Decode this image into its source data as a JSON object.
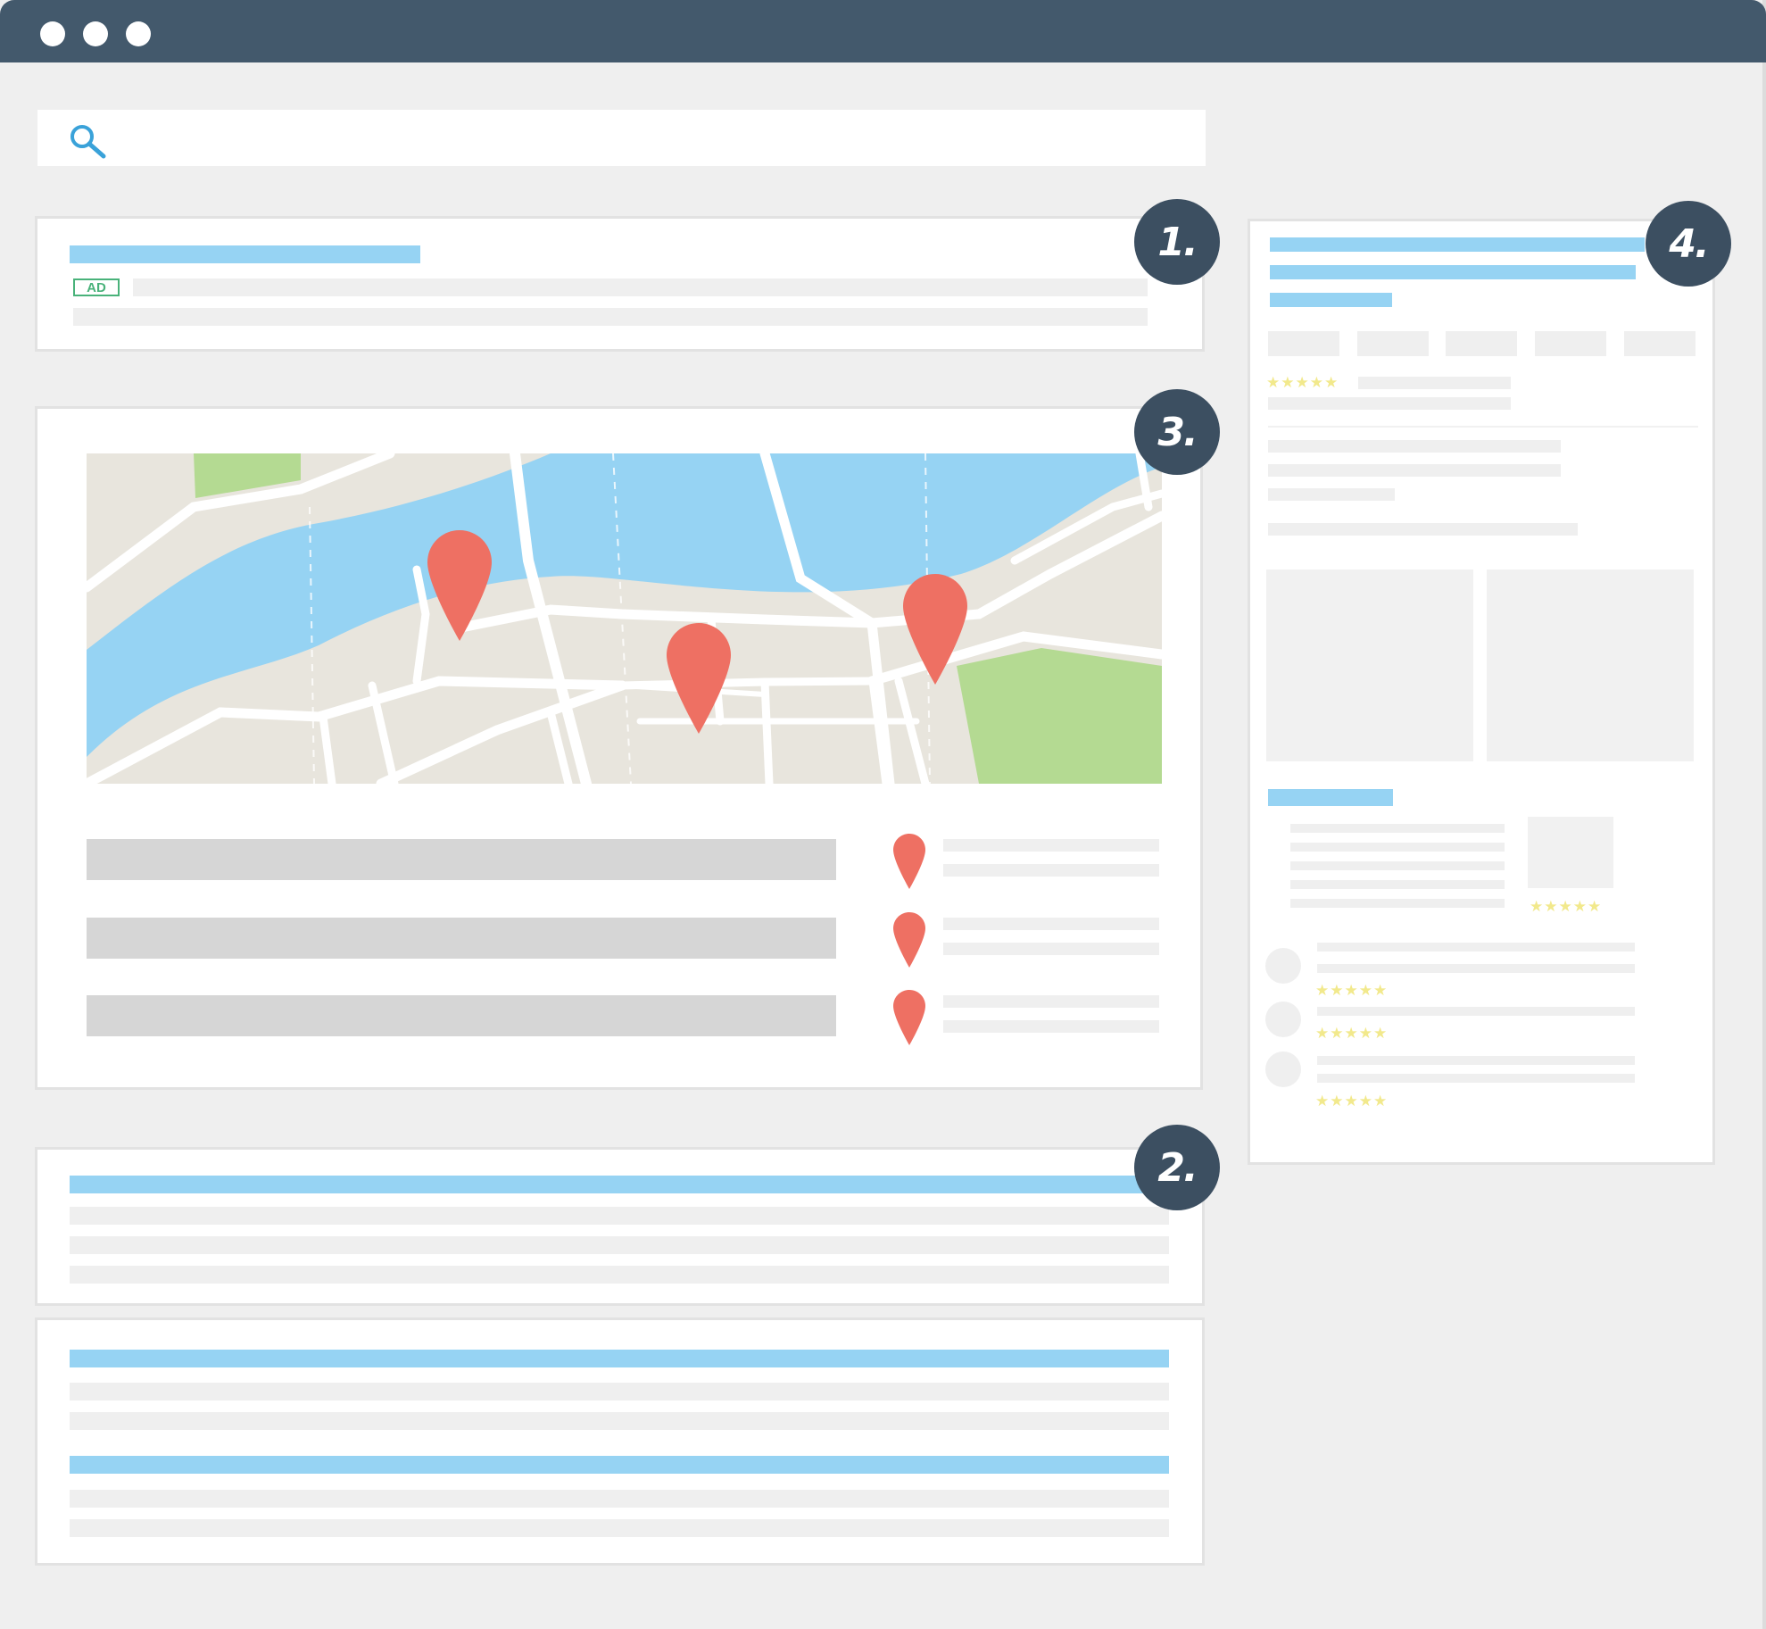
{
  "browser": {
    "window_controls": [
      "dot",
      "dot",
      "dot"
    ],
    "title_bar_color": "#43596c"
  },
  "search": {
    "icon": "search-icon",
    "value": "",
    "icon_color": "#3aa2d9"
  },
  "sections": {
    "ad": {
      "badge": "1.",
      "ad_label": "AD"
    },
    "map_pack": {
      "badge": "3."
    },
    "organic": {
      "badge": "2."
    },
    "knowledge_panel": {
      "badge": "4."
    }
  },
  "colors": {
    "link_bar": "#96d3f3",
    "badge_bg": "#3c4f61",
    "pin": "#ee7063",
    "water": "#96d3f3",
    "park": "#b4da92",
    "land": "#e8e5dd",
    "star": "#f2e98c",
    "ad_border": "#49b27a"
  },
  "ratings": {
    "panel_top": "★★★★★",
    "panel_photo": "★★★★★",
    "review_1": "★★★★★",
    "review_2": "★★★★★",
    "review_3": "★★★★★"
  }
}
